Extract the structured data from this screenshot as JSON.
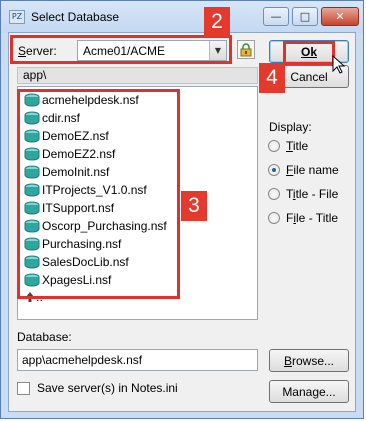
{
  "window": {
    "title": "Select Database",
    "title_icon_glyph": "PZ",
    "min_glyph": "—",
    "max_glyph": "□",
    "close_glyph": "✕"
  },
  "server": {
    "label": "Server:",
    "value": "Acme01/ACME",
    "dropdown_glyph": "▼"
  },
  "buttons": {
    "ok": "Ok",
    "cancel": "Cancel",
    "browse": "Browse...",
    "manage": "Manage..."
  },
  "list": {
    "path": "app\\",
    "items": [
      "acmehelpdesk.nsf",
      "cdir.nsf",
      "DemoEZ.nsf",
      "DemoEZ2.nsf",
      "DemoInit.nsf",
      "ITProjects_V1.0.nsf",
      "ITSupport.nsf",
      "Oscorp_Purchasing.nsf",
      "Purchasing.nsf",
      "SalesDocLib.nsf",
      "XpagesLi.nsf"
    ],
    "up_label": ".."
  },
  "display": {
    "label": "Display:",
    "options": [
      "Title",
      "File name",
      "Title - File",
      "File - Title"
    ],
    "selected": "File name"
  },
  "database": {
    "label": "Database:",
    "value": "app\\acmehelpdesk.nsf"
  },
  "save_servers": {
    "label": "Save server(s) in Notes.ini",
    "checked": false
  },
  "annotations": [
    "2",
    "3",
    "4"
  ],
  "colors": {
    "annotation_red": "#e0322d",
    "db_icon_teal": "#2fa7a0",
    "title_bar": "#c9dcf3"
  },
  "icons": {
    "db": "database-icon",
    "lock": "server-lock-icon",
    "cursor": "mouse-pointer-icon",
    "up": "up-folder-icon"
  }
}
